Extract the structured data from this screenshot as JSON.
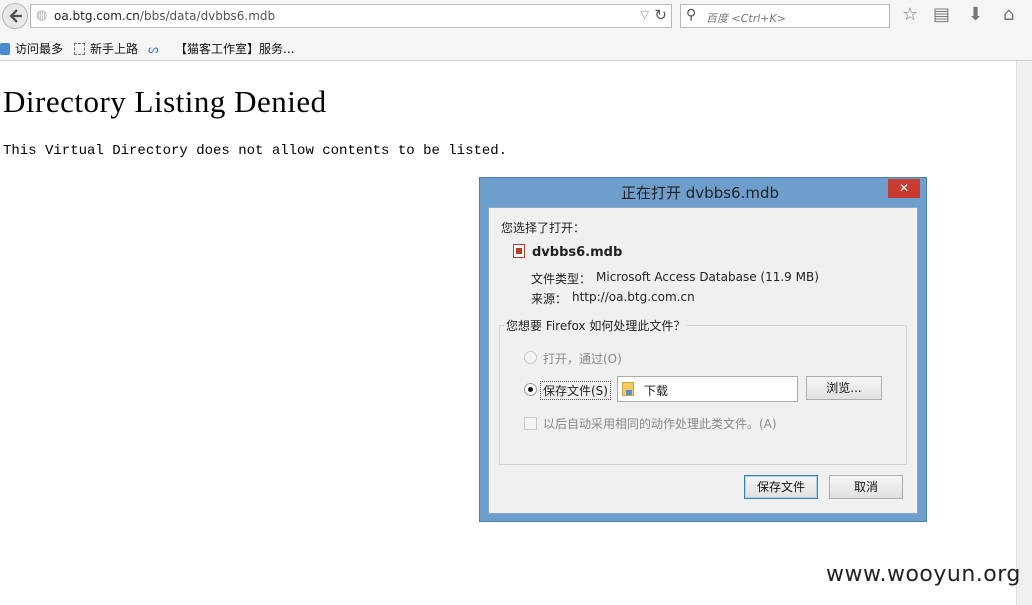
{
  "browser": {
    "url_host": "oa.btg.com.cn",
    "url_path": "/bbs/data/dvbbs6.mdb",
    "search_placeholder": "百度 <Ctrl+K>"
  },
  "bookmarks": [
    {
      "label": "访问最多"
    },
    {
      "label": "新手上路"
    },
    {
      "label": "【猫客工作室】服务..."
    }
  ],
  "page": {
    "heading": "Directory Listing Denied",
    "message": "This Virtual Directory does not allow contents to be listed."
  },
  "dialog": {
    "title": "正在打开 dvbbs6.mdb",
    "close_label": "✕",
    "you_chose": "您选择了打开：",
    "filename": "dvbbs6.mdb",
    "filetype_label": "文件类型：",
    "filetype_value": "Microsoft Access Database (11.9 MB)",
    "source_label": "来源：",
    "source_value": "http://oa.btg.com.cn",
    "question": "您想要 Firefox 如何处理此文件？",
    "open_with_label": "打开，通过(O)",
    "save_file_label": "保存文件(S)",
    "folder_label": "下载",
    "browse_label": "浏览...",
    "auto_label": "以后自动采用相同的动作处理此类文件。(A)",
    "ok_label": "保存文件",
    "cancel_label": "取消"
  },
  "watermark": "www.wooyun.org"
}
